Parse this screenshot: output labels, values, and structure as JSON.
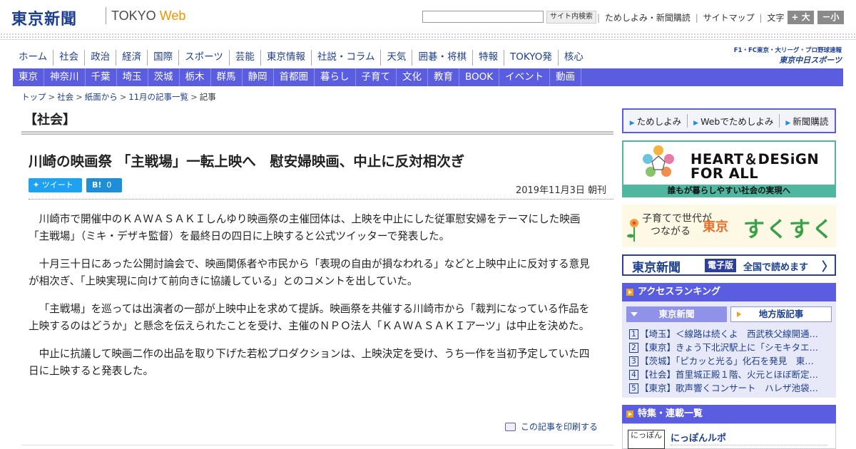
{
  "header": {
    "logo_ja": "東京新聞",
    "logo_en_a": "TOKYO ",
    "logo_en_b": "Web",
    "search_placeholder": "",
    "search_button": "サイト内検索",
    "links": [
      "ためしよみ・新聞購読",
      "サイトマップ"
    ],
    "font_size_label": "文字（0）",
    "font_plus": "+ 大",
    "font_minus": "－小"
  },
  "nav_primary": [
    "ホーム",
    "社会",
    "政治",
    "経済",
    "国際",
    "スポーツ",
    "芸能",
    "東京情報",
    "社説・コラム",
    "天気",
    "囲碁・将棋",
    "特報",
    "TOKYO発",
    "核心"
  ],
  "chunichi": {
    "line1": "F1・FC東京・大リーグ・プロ野球速報",
    "line2": "東京中日スポーツ"
  },
  "nav_regional": [
    "東京",
    "神奈川",
    "千葉",
    "埼玉",
    "茨城",
    "栃木",
    "群馬",
    "静岡",
    "首都圏",
    "暮らし",
    "子育て",
    "文化",
    "教育",
    "BOOK",
    "イベント",
    "動画"
  ],
  "breadcrumb": {
    "items": [
      "トップ",
      "社会",
      "紙面から",
      "11月の記事一覧"
    ],
    "current": "記事"
  },
  "article": {
    "section": "【社会】",
    "headline": "川崎の映画祭 「主戦場」一転上映へ　慰安婦映画、中止に反対相次ぎ",
    "tweet_label": "ツイート",
    "hatena_label": "B!",
    "hatena_count": "0",
    "date": "2019年11月3日 朝刊",
    "paragraphs": [
      "川崎市で開催中のＫＡＷＡＳＡＫＩしんゆり映画祭の主催団体は、上映を中止にした従軍慰安婦をテーマにした映画「主戦場」（ミキ・デザキ監督）を最終日の四日に上映すると公式ツイッターで発表した。",
      "十月三十日にあった公開討論会で、映画関係者や市民から「表現の自由が損なわれる」などと上映中止に反対する意見が相次ぎ、「上映実現に向けて前向きに協議している」とのコメントを出していた。",
      "「主戦場」を巡っては出演者の一部が上映中止を求めて提訴。映画祭を共催する川崎市から「裁判になっている作品を上映するのはどうか」と懸念を伝えられたことを受け、主催のＮＰＯ法人「ＫＡＷＡＳＡＫＩアーツ」は中止を決めた。",
      "中止に抗議して映画二作の出品を取り下げた若松プロダクションは、上映決定を受け、うち一作を当初予定していた四日に上映すると発表した。"
    ],
    "print_label": "この記事を印刷する"
  },
  "sidebar": {
    "tameshi": [
      "ためしよみ",
      "Webでためしよみ",
      "新聞購読"
    ],
    "heart": {
      "line1": "HEART＆DESiGN",
      "line2": "FOR ALL",
      "bar": "誰もが暮らしやすい社会の実現へ"
    },
    "sukusuku": {
      "line1": "子育てで世代が",
      "line2": "つながる",
      "line3": "東京",
      "line4": "すくすく"
    },
    "denshi": {
      "logo": "東京新聞",
      "badge": "電子版",
      "text": "全国で読めます"
    },
    "ranking": {
      "title": "アクセスランキング",
      "tab_active": "東京新聞",
      "tab_inactive": "地方版記事",
      "items": [
        {
          "num": "1",
          "text": "【埼玉】＜線路は続くよ　西武秩父線開通…"
        },
        {
          "num": "2",
          "text": "【東京】きょう下北沢駅上に「シモキタエ…"
        },
        {
          "num": "3",
          "text": "【茨城】「ピカッと光る」化石を発見　東…"
        },
        {
          "num": "4",
          "text": "【社会】首里城正殿１階、火元とほぼ断定…"
        },
        {
          "num": "5",
          "text": "【東京】歌声響くコンサート　ハレザ池袋…"
        }
      ]
    },
    "features": {
      "title": "特集・連載一覧",
      "item_title": "にっぽんルポ",
      "item_thumb": "にっぽん"
    }
  }
}
